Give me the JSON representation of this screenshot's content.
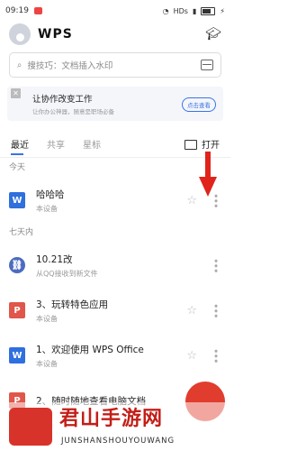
{
  "status_bar": {
    "time": "09:19",
    "network": "HDs",
    "battery": "⚡"
  },
  "header": {
    "logo": "WPS",
    "hat_icon": "mortarboard-icon"
  },
  "search": {
    "placeholder": "搜技巧：文档插入水印"
  },
  "banner": {
    "title": "让协作改变工作",
    "subtitle": "让你办公神器，随意是职场必备",
    "button": "点击查看"
  },
  "tabs": {
    "items": [
      "最近",
      "共享",
      "星标"
    ],
    "active": "最近",
    "open_label": "打开"
  },
  "sections": {
    "today": "今天",
    "week": "七天内"
  },
  "files": [
    {
      "name": "哈哈哈",
      "sub": "本设备",
      "type": "W",
      "star": true
    },
    {
      "name": "10.21改",
      "sub": "从QQ接收到新文件",
      "type": "link",
      "star": false
    },
    {
      "name": "3、玩转特色应用",
      "sub": "本设备",
      "type": "P",
      "star": true
    },
    {
      "name": "1、欢迎使用 WPS Office",
      "sub": "本设备",
      "type": "W",
      "star": true
    },
    {
      "name": "2、随时随地查看电脑文档",
      "sub": "",
      "type": "P",
      "star": false
    }
  ],
  "colors": {
    "accent": "#3b73e8",
    "annotation_arrow": "#e0241b",
    "fab": "#e03d2e"
  },
  "watermark": {
    "cn": "君山手游网",
    "en": "JUNSHANSHOUYOUWANG"
  }
}
